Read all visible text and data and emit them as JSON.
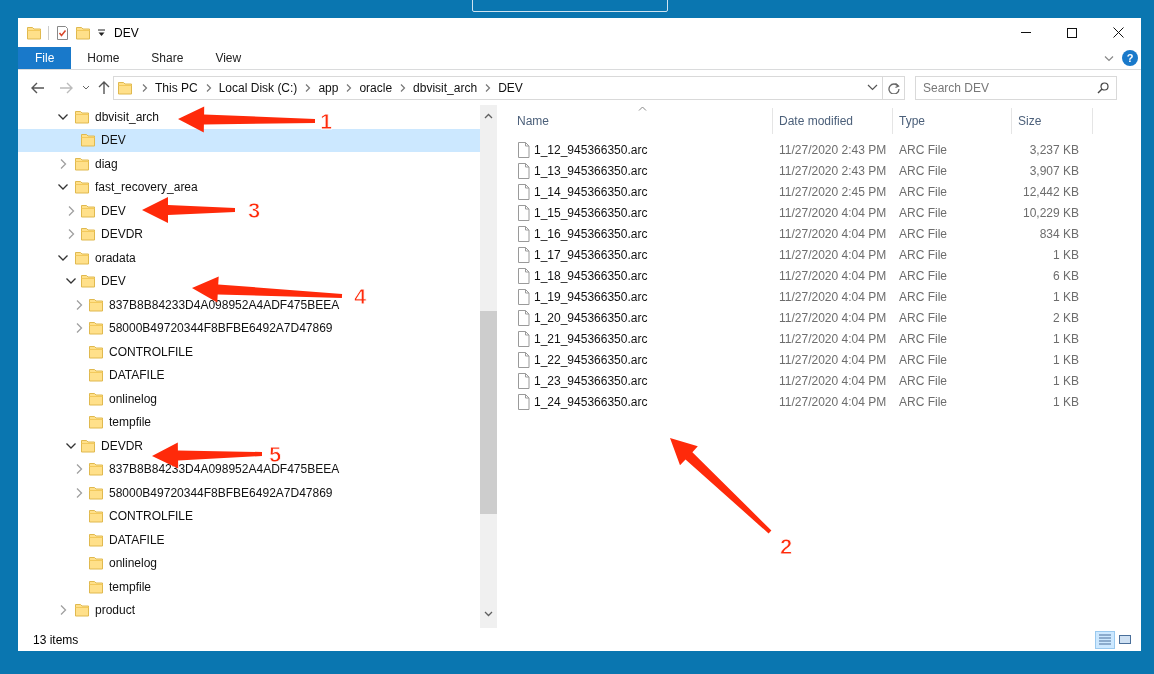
{
  "window": {
    "title": "DEV"
  },
  "ribbon": {
    "tabs": [
      {
        "label": "File",
        "selected": true
      },
      {
        "label": "Home",
        "selected": false
      },
      {
        "label": "Share",
        "selected": false
      },
      {
        "label": "View",
        "selected": false
      }
    ],
    "help_label": "?"
  },
  "address_bar": {
    "segments": [
      "This PC",
      "Local Disk (C:)",
      "app",
      "oracle",
      "dbvisit_arch",
      "DEV"
    ]
  },
  "search": {
    "placeholder": "Search DEV"
  },
  "navigation_tree": [
    {
      "label": "dbvisit_arch",
      "kind": "expanded",
      "selected": false,
      "children": [
        {
          "label": "DEV",
          "kind": "leaf",
          "selected": true
        }
      ]
    },
    {
      "label": "diag",
      "kind": "collapsed",
      "selected": false
    },
    {
      "label": "fast_recovery_area",
      "kind": "expanded",
      "selected": false,
      "children": [
        {
          "label": "DEV",
          "kind": "collapsed",
          "selected": false
        },
        {
          "label": "DEVDR",
          "kind": "collapsed",
          "selected": false
        }
      ]
    },
    {
      "label": "oradata",
      "kind": "expanded",
      "selected": false,
      "children": [
        {
          "label": "DEV",
          "kind": "expanded",
          "selected": false,
          "children": [
            {
              "label": "837B8B84233D4A098952A4ADF475BEEA",
              "kind": "collapsed",
              "selected": false
            },
            {
              "label": "58000B49720344F8BFBE6492A7D47869",
              "kind": "collapsed",
              "selected": false
            },
            {
              "label": "CONTROLFILE",
              "kind": "leaf",
              "selected": false
            },
            {
              "label": "DATAFILE",
              "kind": "leaf",
              "selected": false
            },
            {
              "label": "onlinelog",
              "kind": "leaf",
              "selected": false
            },
            {
              "label": "tempfile",
              "kind": "leaf",
              "selected": false
            }
          ]
        },
        {
          "label": "DEVDR",
          "kind": "expanded",
          "selected": false,
          "children": [
            {
              "label": "837B8B84233D4A098952A4ADF475BEEA",
              "kind": "collapsed",
              "selected": false
            },
            {
              "label": "58000B49720344F8BFBE6492A7D47869",
              "kind": "collapsed",
              "selected": false
            },
            {
              "label": "CONTROLFILE",
              "kind": "leaf",
              "selected": false
            },
            {
              "label": "DATAFILE",
              "kind": "leaf",
              "selected": false
            },
            {
              "label": "onlinelog",
              "kind": "leaf",
              "selected": false
            },
            {
              "label": "tempfile",
              "kind": "leaf",
              "selected": false
            }
          ]
        }
      ]
    },
    {
      "label": "product",
      "kind": "collapsed",
      "selected": false
    }
  ],
  "file_list": {
    "columns": [
      "Name",
      "Date modified",
      "Type",
      "Size"
    ],
    "rows": [
      {
        "name": "1_12_945366350.arc",
        "date": "11/27/2020 2:43 PM",
        "type": "ARC File",
        "size": "3,237 KB"
      },
      {
        "name": "1_13_945366350.arc",
        "date": "11/27/2020 2:43 PM",
        "type": "ARC File",
        "size": "3,907 KB"
      },
      {
        "name": "1_14_945366350.arc",
        "date": "11/27/2020 2:45 PM",
        "type": "ARC File",
        "size": "12,442 KB"
      },
      {
        "name": "1_15_945366350.arc",
        "date": "11/27/2020 4:04 PM",
        "type": "ARC File",
        "size": "10,229 KB"
      },
      {
        "name": "1_16_945366350.arc",
        "date": "11/27/2020 4:04 PM",
        "type": "ARC File",
        "size": "834 KB"
      },
      {
        "name": "1_17_945366350.arc",
        "date": "11/27/2020 4:04 PM",
        "type": "ARC File",
        "size": "1 KB"
      },
      {
        "name": "1_18_945366350.arc",
        "date": "11/27/2020 4:04 PM",
        "type": "ARC File",
        "size": "6 KB"
      },
      {
        "name": "1_19_945366350.arc",
        "date": "11/27/2020 4:04 PM",
        "type": "ARC File",
        "size": "1 KB"
      },
      {
        "name": "1_20_945366350.arc",
        "date": "11/27/2020 4:04 PM",
        "type": "ARC File",
        "size": "2 KB"
      },
      {
        "name": "1_21_945366350.arc",
        "date": "11/27/2020 4:04 PM",
        "type": "ARC File",
        "size": "1 KB"
      },
      {
        "name": "1_22_945366350.arc",
        "date": "11/27/2020 4:04 PM",
        "type": "ARC File",
        "size": "1 KB"
      },
      {
        "name": "1_23_945366350.arc",
        "date": "11/27/2020 4:04 PM",
        "type": "ARC File",
        "size": "1 KB"
      },
      {
        "name": "1_24_945366350.arc",
        "date": "11/27/2020 4:04 PM",
        "type": "ARC File",
        "size": "1 KB"
      }
    ]
  },
  "status_bar": {
    "item_count": "13 items",
    "views": [
      {
        "kind": "details",
        "selected": true
      },
      {
        "kind": "large_icons",
        "selected": false
      }
    ]
  },
  "annotations": [
    {
      "label": "1"
    },
    {
      "label": "2"
    },
    {
      "label": "3"
    },
    {
      "label": "4"
    },
    {
      "label": "5"
    }
  ]
}
